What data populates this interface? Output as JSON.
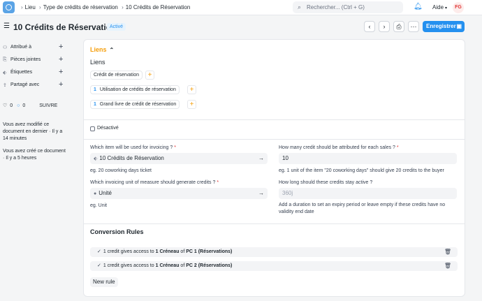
{
  "topbar": {
    "breadcrumbs": [
      "Lieu",
      "Type de crédits de réservation",
      "10 Crédits de Réservation"
    ],
    "search_placeholder": "Rechercher... (Ctrl + G)",
    "help_label": "Aide",
    "avatar_initials": "FG"
  },
  "page": {
    "title": "10 Crédits de Réservation",
    "status": "Activé",
    "save_label": "Enregistrer",
    "accent_color": "#2490ef"
  },
  "sidebar": {
    "items": [
      {
        "label": "Attribué à",
        "icon": "assign-icon"
      },
      {
        "label": "Pièces jointes",
        "icon": "paperclip-icon"
      },
      {
        "label": "Étiquettes",
        "icon": "tag-icon"
      },
      {
        "label": "Partagé avec",
        "icon": "share-icon"
      }
    ],
    "likes": "0",
    "comments": "0",
    "follow_label": "SUIVRE",
    "activity": [
      "Vous avez modifié ce document en dernier · Il y a 14 minutes",
      "Vous avez créé ce document · Il y a 5 heures"
    ]
  },
  "links_section": {
    "title": "Liens",
    "subtitle": "Liens",
    "groups": [
      {
        "label": "Crédit de réservation",
        "count": ""
      },
      {
        "label": "Utilisation de crédits de réservation",
        "count": "1"
      },
      {
        "label": "Grand livre de crédit de réservation",
        "count": "1"
      }
    ]
  },
  "form": {
    "disabled_label": "Désactivé",
    "item_label": "Which item will be used for invoicing ?",
    "item_value": "10 Crédits de Réservation",
    "item_help": "eg. 20 coworking days ticket",
    "credits_label": "How many credit should be attributed for each sales ?",
    "credits_value": "10",
    "credits_help": "eg. 1 unit of the item \"20 coworking days\" should give 20 credits to the buyer",
    "uom_label": "Which invoicing unit of measure should generate credits ?",
    "uom_value": "Unité",
    "uom_help": "eg. Unit",
    "validity_label": "How long should these credits stay active ?",
    "validity_placeholder": "360j",
    "validity_help": "Add a duration to set an expiry period or leave empty if these credits have no validity end date",
    "required_mark": "*"
  },
  "conversion": {
    "title": "Conversion Rules",
    "rules": [
      {
        "prefix": "1 credit gives access to",
        "qty": "1",
        "unit": "Créneau",
        "of": "of",
        "target": "PC 1 (Réservations)"
      },
      {
        "prefix": "1 credit gives access to",
        "qty": "1",
        "unit": "Créneau",
        "of": "of",
        "target": "PC 2 (Réservations)"
      }
    ],
    "new_rule_label": "New rule"
  }
}
